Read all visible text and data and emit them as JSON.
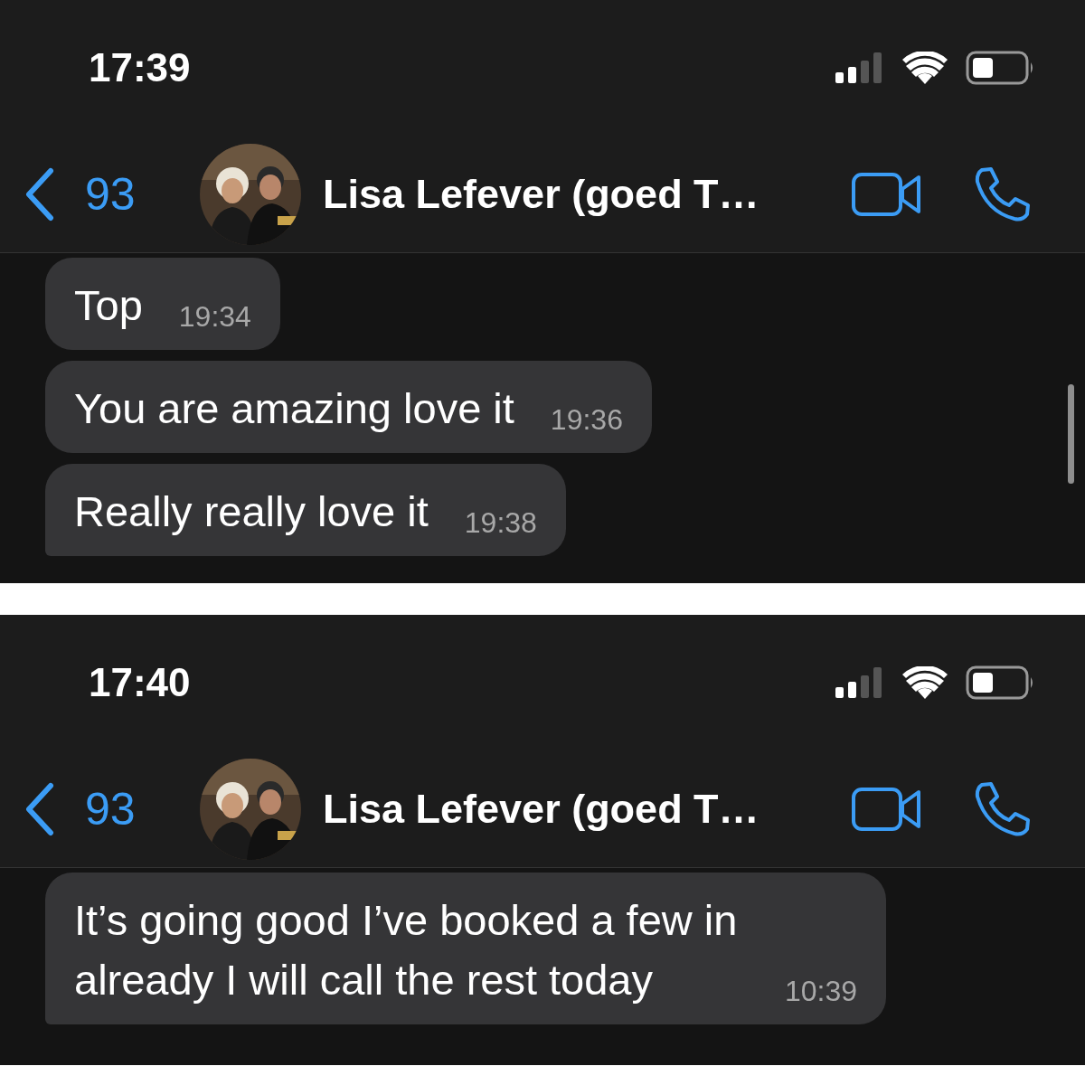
{
  "screenshots": [
    {
      "status_bar": {
        "time": "17:39"
      },
      "header": {
        "back_count": "93",
        "contact_name": "Lisa Lefever (goed T…"
      },
      "scrollbar": true,
      "messages": [
        {
          "text": "Top",
          "time": "19:34",
          "tail": false
        },
        {
          "text": "You are amazing love it",
          "time": "19:36",
          "tail": false
        },
        {
          "text": "Really really love it",
          "time": "19:38",
          "tail": true
        }
      ]
    },
    {
      "status_bar": {
        "time": "17:40"
      },
      "header": {
        "back_count": "93",
        "contact_name": "Lisa Lefever (goed T…"
      },
      "scrollbar": false,
      "messages": [
        {
          "text": "It’s going good I’ve booked a few in already I will call the rest today",
          "time": "10:39",
          "tail": true
        }
      ]
    }
  ]
}
